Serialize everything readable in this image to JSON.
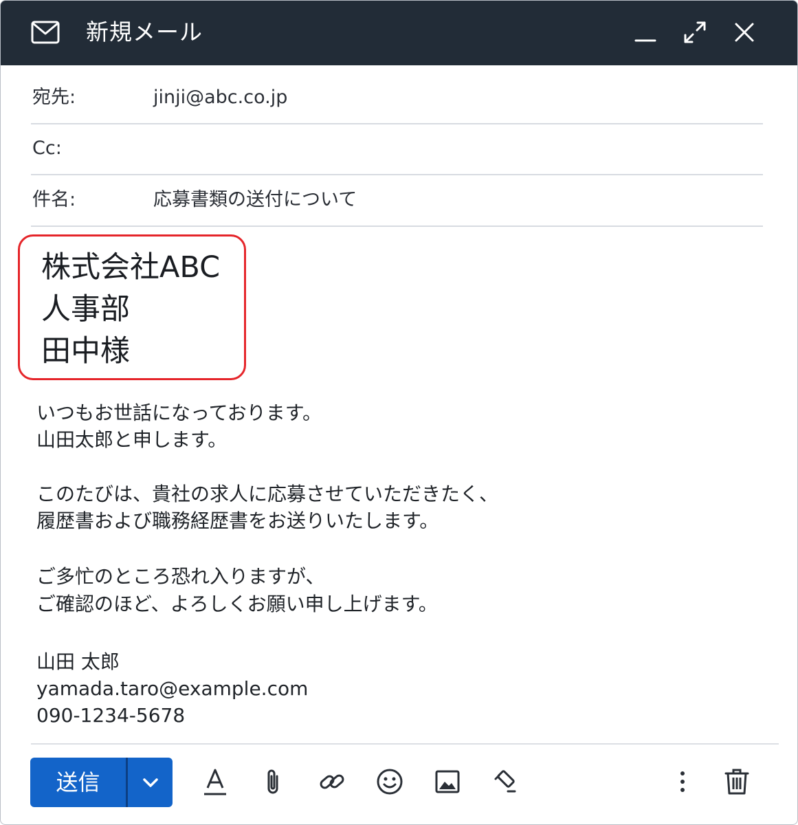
{
  "window": {
    "title": "新規メール"
  },
  "fields": {
    "to": {
      "label": "宛先:",
      "value": "jinji@abc.co.jp"
    },
    "cc": {
      "label": "Cc:",
      "value": ""
    },
    "subject": {
      "label": "件名:",
      "value": "応募書類の送付について"
    }
  },
  "recipient_block": {
    "company": "株式会社ABC",
    "department": "人事部",
    "name": "田中様",
    "highlight_color": "#e5252a"
  },
  "body": {
    "greeting_1": "いつもお世話になっております。",
    "greeting_2": "山田太郎と申します。",
    "para_1": "このたびは、貴社の求人に応募させていただきたく、",
    "para_2": "履歴書および職務経歴書をお送りいたします。",
    "closing_1": "ご多忙のところ恐れ入りますが、",
    "closing_2": "ご確認のほど、よろしくお願い申し上げます。"
  },
  "signature": {
    "name": "山田 太郎",
    "email": "yamada.taro@example.com",
    "phone": "090-1234-5678"
  },
  "toolbar": {
    "send_label": "送信",
    "send_color": "#1364c9",
    "icons": [
      "format-text-icon",
      "attach-icon",
      "link-icon",
      "emoji-icon",
      "image-icon",
      "draw-icon",
      "more-options-icon",
      "trash-icon"
    ]
  },
  "colors": {
    "titlebar": "#222c37"
  }
}
